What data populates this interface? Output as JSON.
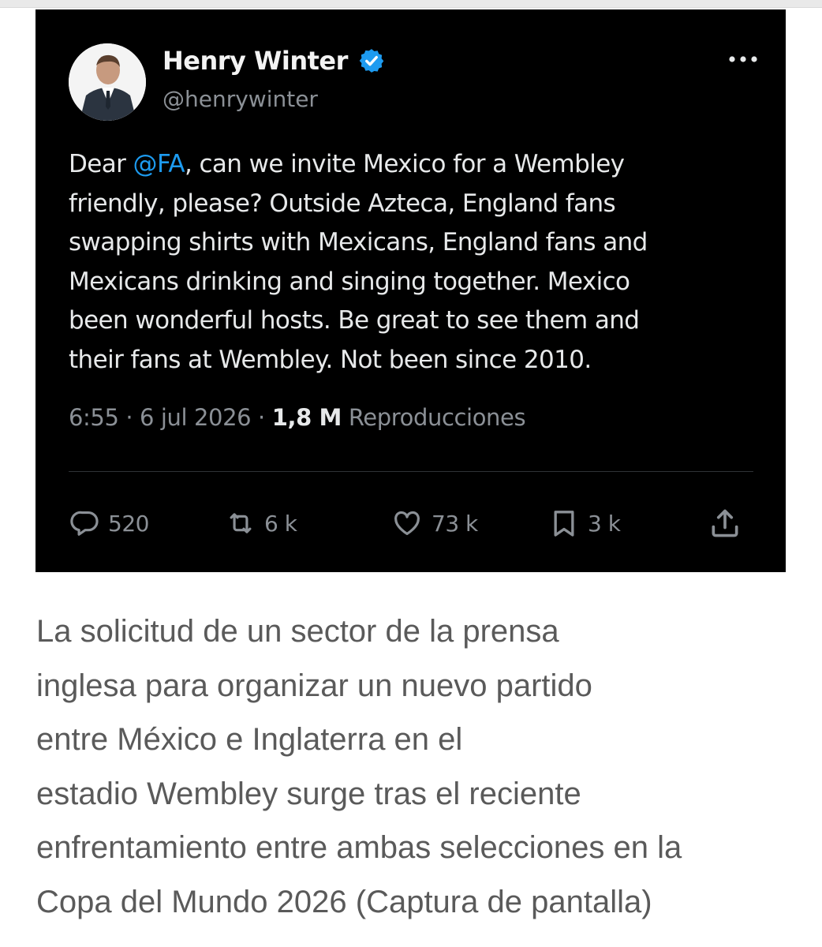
{
  "tweet": {
    "display_name": "Henry Winter",
    "handle": "@henrywinter",
    "text_before_mention": "Dear ",
    "mention": "@FA",
    "text_lines": [
      ", can we invite Mexico for a Wembley",
      "friendly, please? Outside Azteca, England fans",
      "swapping shirts with Mexicans, England fans and",
      "Mexicans drinking and singing together. Mexico",
      "been wonderful hosts. Be great to see them and",
      "their fans at Wembley. Not been since 2010."
    ],
    "time": "6:55",
    "date": "6 jul 2026",
    "separator": "·",
    "views_count": "1,8 M",
    "views_label": "Reproducciones",
    "actions": {
      "replies": "520",
      "reposts": "6 k",
      "likes": "73 k",
      "bookmarks": "3 k"
    },
    "icons": {
      "verified": "verified-badge-icon",
      "more": "more-options-icon",
      "reply": "reply-icon",
      "repost": "repost-icon",
      "like": "heart-icon",
      "bookmark": "bookmark-icon",
      "share": "share-icon"
    },
    "colors": {
      "background": "#000000",
      "text": "#e7e9ea",
      "muted": "#8b9096",
      "accent": "#1d9bf0"
    }
  },
  "caption_lines": [
    "La solicitud de un sector de la prensa",
    "inglesa para organizar un nuevo partido",
    "entre México e Inglaterra en el",
    "estadio Wembley surge tras el reciente",
    "enfrentamiento entre ambas selecciones en la",
    "Copa del Mundo 2026 (Captura de pantalla)"
  ]
}
